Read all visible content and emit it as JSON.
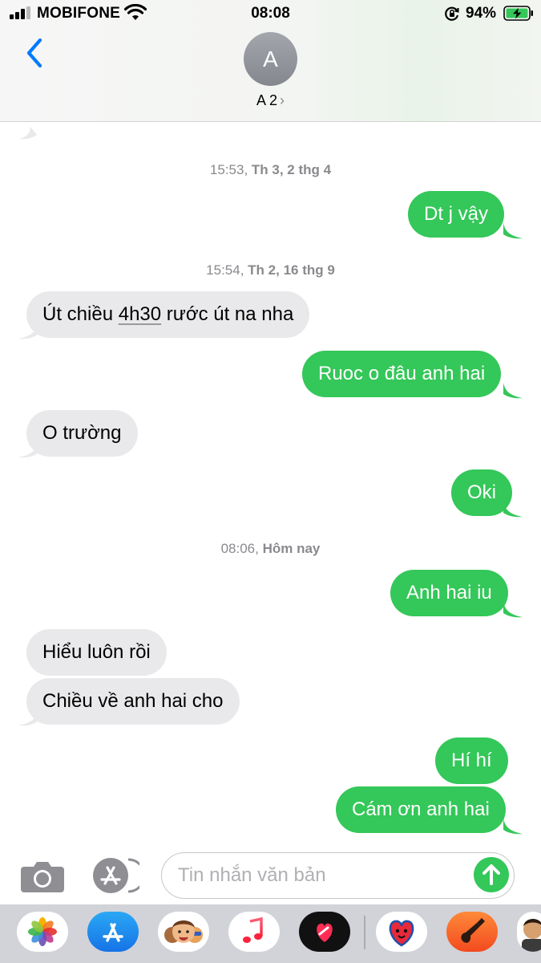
{
  "status_bar": {
    "carrier": "MOBIFONE",
    "time": "08:08",
    "battery_percent": "94%"
  },
  "header": {
    "avatar_initial": "A",
    "contact_name": "A 2",
    "contact_chevron": "›"
  },
  "conversation": {
    "timestamps": [
      {
        "time": "15:53,",
        "day": "Th 3, 2 thg 4"
      },
      {
        "time": "15:54,",
        "day": "Th 2, 16 thg 9"
      },
      {
        "time": "08:06,",
        "day": "Hôm nay"
      }
    ],
    "messages": [
      {
        "from": "me",
        "text": "Dt j vậy"
      },
      {
        "from": "them",
        "text_before": "Út chiều ",
        "text_link": "4h30",
        "text_after": " rước út na nha"
      },
      {
        "from": "me",
        "text": "Ruoc o đâu anh hai"
      },
      {
        "from": "them",
        "text": "O trường"
      },
      {
        "from": "me",
        "text": "Oki"
      },
      {
        "from": "me",
        "text": "Anh hai iu"
      },
      {
        "from": "them",
        "text": "Hiểu luôn rồi"
      },
      {
        "from": "them",
        "text": "Chiều về anh hai cho"
      },
      {
        "from": "me",
        "text": "Hí hí"
      },
      {
        "from": "me",
        "text": "Cám ơn anh hai"
      }
    ]
  },
  "composer": {
    "placeholder": "Tin nhắn văn bản"
  },
  "drawer": {
    "apps": [
      "photos-icon",
      "app-store-icon",
      "memoji-icon",
      "music-icon",
      "digital-touch-icon",
      "sticker-icon",
      "garageband-icon",
      "avatar-sticker-icon"
    ]
  },
  "colors": {
    "sent_bubble": "#34c759",
    "received_bubble": "#e9e9eb",
    "accent": "#007aff",
    "drawer_bg": "#d1d3d9"
  }
}
